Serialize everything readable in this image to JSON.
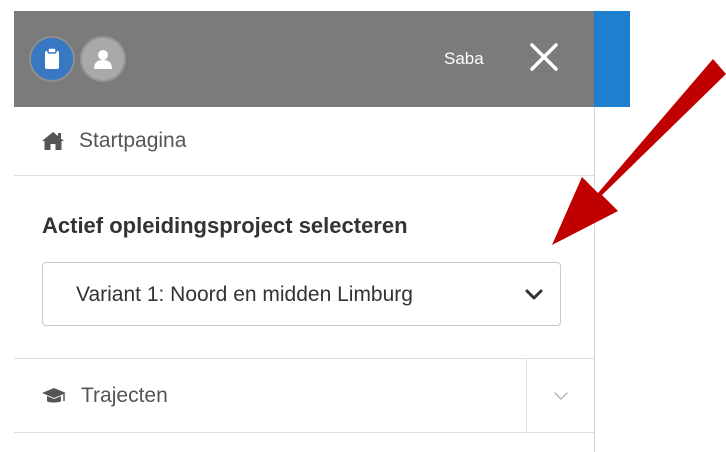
{
  "topbar": {
    "username": "Saba",
    "color": "#7b7b7b",
    "accent_strip_color": "#1e7fcf",
    "clipboard_button_color": "#3877c2",
    "user_button_color": "#a9a9a9"
  },
  "nav": {
    "home_label": "Startpagina",
    "home_icon": "home-icon",
    "trajecten_label": "Trajecten",
    "trajecten_icon": "graduation-cap-icon"
  },
  "project_select": {
    "title": "Actief opleidingsproject selecteren",
    "selected_value": "Variant 1: Noord en midden Limburg"
  },
  "annotation": {
    "arrow_color": "#c00000"
  }
}
